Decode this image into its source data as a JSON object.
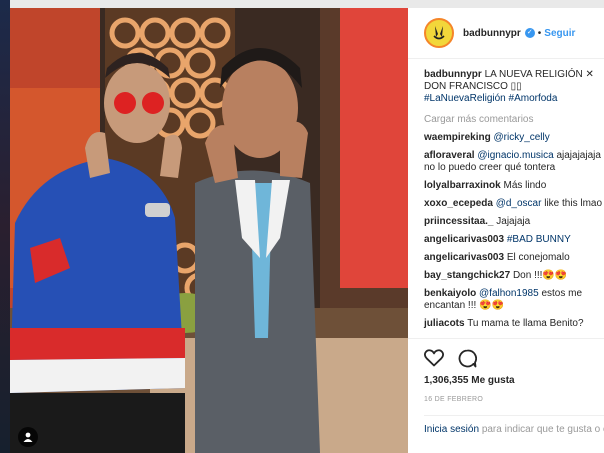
{
  "post": {
    "username": "badbunnypr",
    "follow_label": "Seguir",
    "caption_user": "badbunnypr",
    "caption_text": "LA NUEVA RELIGIÓN ✕ DON FRANCISCO ▯▯",
    "caption_tag1": "#LaNuevaReligión",
    "caption_tag2": "#Amorfoda",
    "load_more": "Cargar más comentarios",
    "likes": "1,306,355 Me gusta",
    "date": "16 DE FEBRERO",
    "login_link": "Inicia sesión",
    "login_text": "para indicar que te gusta o comentar."
  },
  "comments": [
    {
      "user": "waempireking",
      "mention": "@ricky_celly",
      "text": ""
    },
    {
      "user": "afloraveral",
      "mention": "@ignacio.musica",
      "text": "ajajajajaja no lo puedo creer qué tontera"
    },
    {
      "user": "lolyalbarraxinok",
      "mention": "",
      "text": "Más lindo"
    },
    {
      "user": "xoxo_ecepeda",
      "mention": "@d_oscar",
      "text": "like this lmao"
    },
    {
      "user": "priincessitaa._",
      "mention": "",
      "text": "Jajajaja"
    },
    {
      "user": "angelicarivas003",
      "mention": "",
      "text": "#BAD BUNNY"
    },
    {
      "user": "angelicarivas003",
      "mention": "",
      "text": "El conejomalo"
    },
    {
      "user": "bay_stangchick27",
      "mention": "",
      "text": "Don !!!😍😍"
    },
    {
      "user": "benkaiyolo",
      "mention": "@falhon1985",
      "text": "estos me encantan !!! 😍😍"
    },
    {
      "user": "juliacots",
      "mention": "",
      "text": "Tu mama te llama Benito?"
    }
  ],
  "colors": {
    "accent": "#3897f0",
    "link": "#003569",
    "muted": "#999999"
  }
}
